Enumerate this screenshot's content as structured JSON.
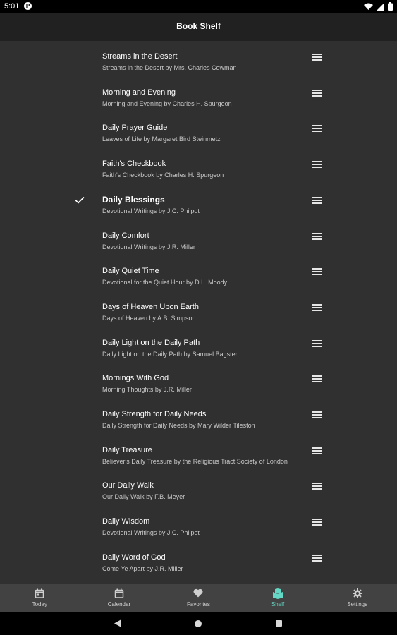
{
  "status_bar": {
    "time": "5:01",
    "app_icon_letter": "P"
  },
  "app_bar": {
    "title": "Book Shelf"
  },
  "books": [
    {
      "title": "Streams in the Desert",
      "subtitle": "Streams in the Desert by Mrs. Charles Cowman",
      "selected": false
    },
    {
      "title": "Morning and Evening",
      "subtitle": "Morning and Evening by Charles H. Spurgeon",
      "selected": false
    },
    {
      "title": "Daily Prayer Guide",
      "subtitle": "Leaves of Life by Margaret Bird Steinmetz",
      "selected": false
    },
    {
      "title": "Faith's Checkbook",
      "subtitle": "Faith's Checkbook by Charles H. Spurgeon",
      "selected": false
    },
    {
      "title": "Daily Blessings",
      "subtitle": "Devotional Writings by J.C. Philpot",
      "selected": true
    },
    {
      "title": "Daily Comfort",
      "subtitle": "Devotional Writings by J.R. Miller",
      "selected": false
    },
    {
      "title": "Daily Quiet Time",
      "subtitle": "Devotional for the Quiet Hour by D.L. Moody",
      "selected": false
    },
    {
      "title": "Days of Heaven Upon Earth",
      "subtitle": "Days of Heaven by A.B. Simpson",
      "selected": false
    },
    {
      "title": "Daily Light on the Daily Path",
      "subtitle": "Daily Light on the Daily Path by Samuel Bagster",
      "selected": false
    },
    {
      "title": "Mornings With God",
      "subtitle": "Morning Thoughts by J.R. Miller",
      "selected": false
    },
    {
      "title": "Daily Strength for Daily Needs",
      "subtitle": "Daily Strength for Daily Needs by Mary Wilder Tileston",
      "selected": false
    },
    {
      "title": "Daily Treasure",
      "subtitle": "Believer's Daily Treasure by the Religious Tract Society of London",
      "selected": false
    },
    {
      "title": "Our Daily Walk",
      "subtitle": "Our Daily Walk by F.B. Meyer",
      "selected": false
    },
    {
      "title": "Daily Wisdom",
      "subtitle": "Devotional Writings by J.C. Philpot",
      "selected": false
    },
    {
      "title": "Daily Word of God",
      "subtitle": "Come Ye Apart by J.R. Miller",
      "selected": false
    }
  ],
  "bottom_nav": [
    {
      "label": "Today",
      "icon": "calendar-today-icon",
      "active": false
    },
    {
      "label": "Calendar",
      "icon": "calendar-icon",
      "active": false
    },
    {
      "label": "Favorites",
      "icon": "heart-icon",
      "active": false
    },
    {
      "label": "Shelf",
      "icon": "book-shelf-icon",
      "active": true
    },
    {
      "label": "Settings",
      "icon": "gear-icon",
      "active": false
    }
  ],
  "colors": {
    "background": "#303030",
    "app_bar": "#212121",
    "bottom_nav": "#424242",
    "accent": "#64d8c4"
  }
}
